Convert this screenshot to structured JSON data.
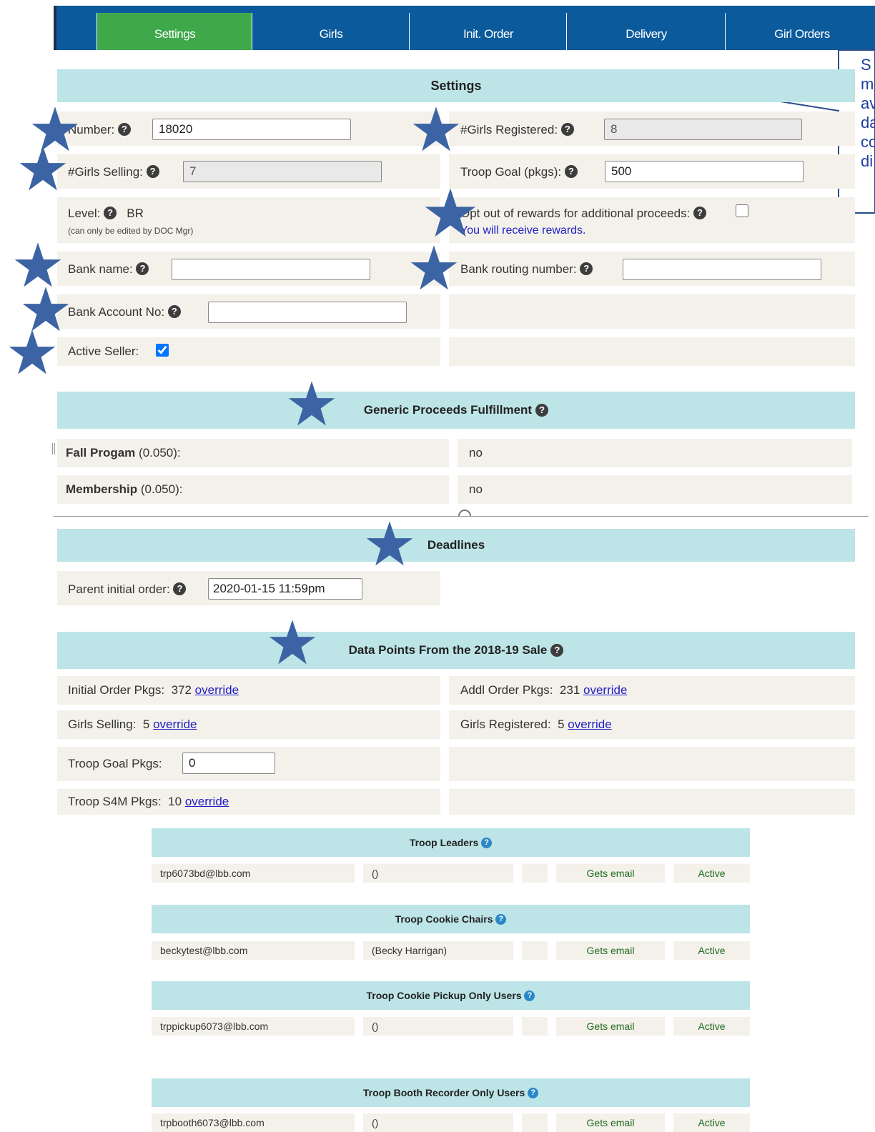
{
  "nav": {
    "tabs": [
      {
        "label": "Settings",
        "active": true
      },
      {
        "label": "Girls",
        "active": false
      },
      {
        "label": "Init. Order",
        "active": false
      },
      {
        "label": "Delivery",
        "active": false
      },
      {
        "label": "Girl Orders",
        "active": false
      }
    ]
  },
  "callout": {
    "lines": [
      "S",
      "m",
      "av",
      "da",
      "co",
      "di"
    ]
  },
  "settings": {
    "header": "Settings",
    "number_label": "Number:",
    "number_value": "18020",
    "girls_registered_label": "#Girls Registered:",
    "girls_registered_value": "8",
    "girls_selling_label": "#Girls Selling:",
    "girls_selling_value": "7",
    "troop_goal_label": "Troop Goal (pkgs):",
    "troop_goal_value": "500",
    "level_label": "Level:",
    "level_value": "BR",
    "level_note": "(can only be edited by DOC Mgr)",
    "opt_out_label": "Opt out of rewards for additional proceeds:",
    "opt_out_checked": false,
    "rewards_note": "You will receive rewards.",
    "bank_name_label": "Bank name:",
    "bank_name_value": "",
    "bank_routing_label": "Bank routing number:",
    "bank_routing_value": "",
    "bank_account_label": "Bank Account No:",
    "bank_account_value": "",
    "active_seller_label": "Active Seller:",
    "active_seller_checked": true
  },
  "generic": {
    "header": "Generic Proceeds Fulfillment",
    "rows": [
      {
        "name": "Fall Progam",
        "rate": "(0.050):",
        "value": "no"
      },
      {
        "name": "Membership",
        "rate": "(0.050):",
        "value": "no"
      }
    ]
  },
  "deadlines": {
    "header": "Deadlines",
    "parent_label": "Parent initial order:",
    "parent_value": "2020-01-15 11:59pm"
  },
  "datapoints": {
    "header": "Data Points From the 2018-19 Sale",
    "initial_label": "Initial Order Pkgs:",
    "initial_value": "372",
    "addl_label": "Addl Order Pkgs:",
    "addl_value": "231",
    "girls_selling_label": "Girls Selling:",
    "girls_selling_value": "5",
    "girls_registered_label": "Girls Registered:",
    "girls_registered_value": "5",
    "troop_goal_label": "Troop Goal Pkgs:",
    "troop_goal_value": "0",
    "s4m_label": "Troop S4M Pkgs:",
    "s4m_value": "10",
    "override": "override"
  },
  "user_tables": [
    {
      "title": "Troop Leaders",
      "email": "trp6073bd@lbb.com",
      "name": "()",
      "email_status": "Gets email",
      "status": "Active"
    },
    {
      "title": "Troop Cookie Chairs",
      "email": "beckytest@lbb.com",
      "name": "(Becky Harrigan)",
      "email_status": "Gets email",
      "status": "Active"
    },
    {
      "title": "Troop Cookie Pickup Only Users",
      "email": "trppickup6073@lbb.com",
      "name": "()",
      "email_status": "Gets email",
      "status": "Active"
    },
    {
      "title": "Troop Booth Recorder Only Users",
      "email": "trpbooth6073@lbb.com",
      "name": "()",
      "email_status": "Gets email",
      "status": "Active"
    }
  ],
  "colors": {
    "nav_bg": "#0a5a9c",
    "active_tab": "#3ea84a",
    "section_header": "#bde4e6",
    "row_bg": "#f3f1ea",
    "star": "#3c64a4",
    "link": "#2020c8"
  }
}
